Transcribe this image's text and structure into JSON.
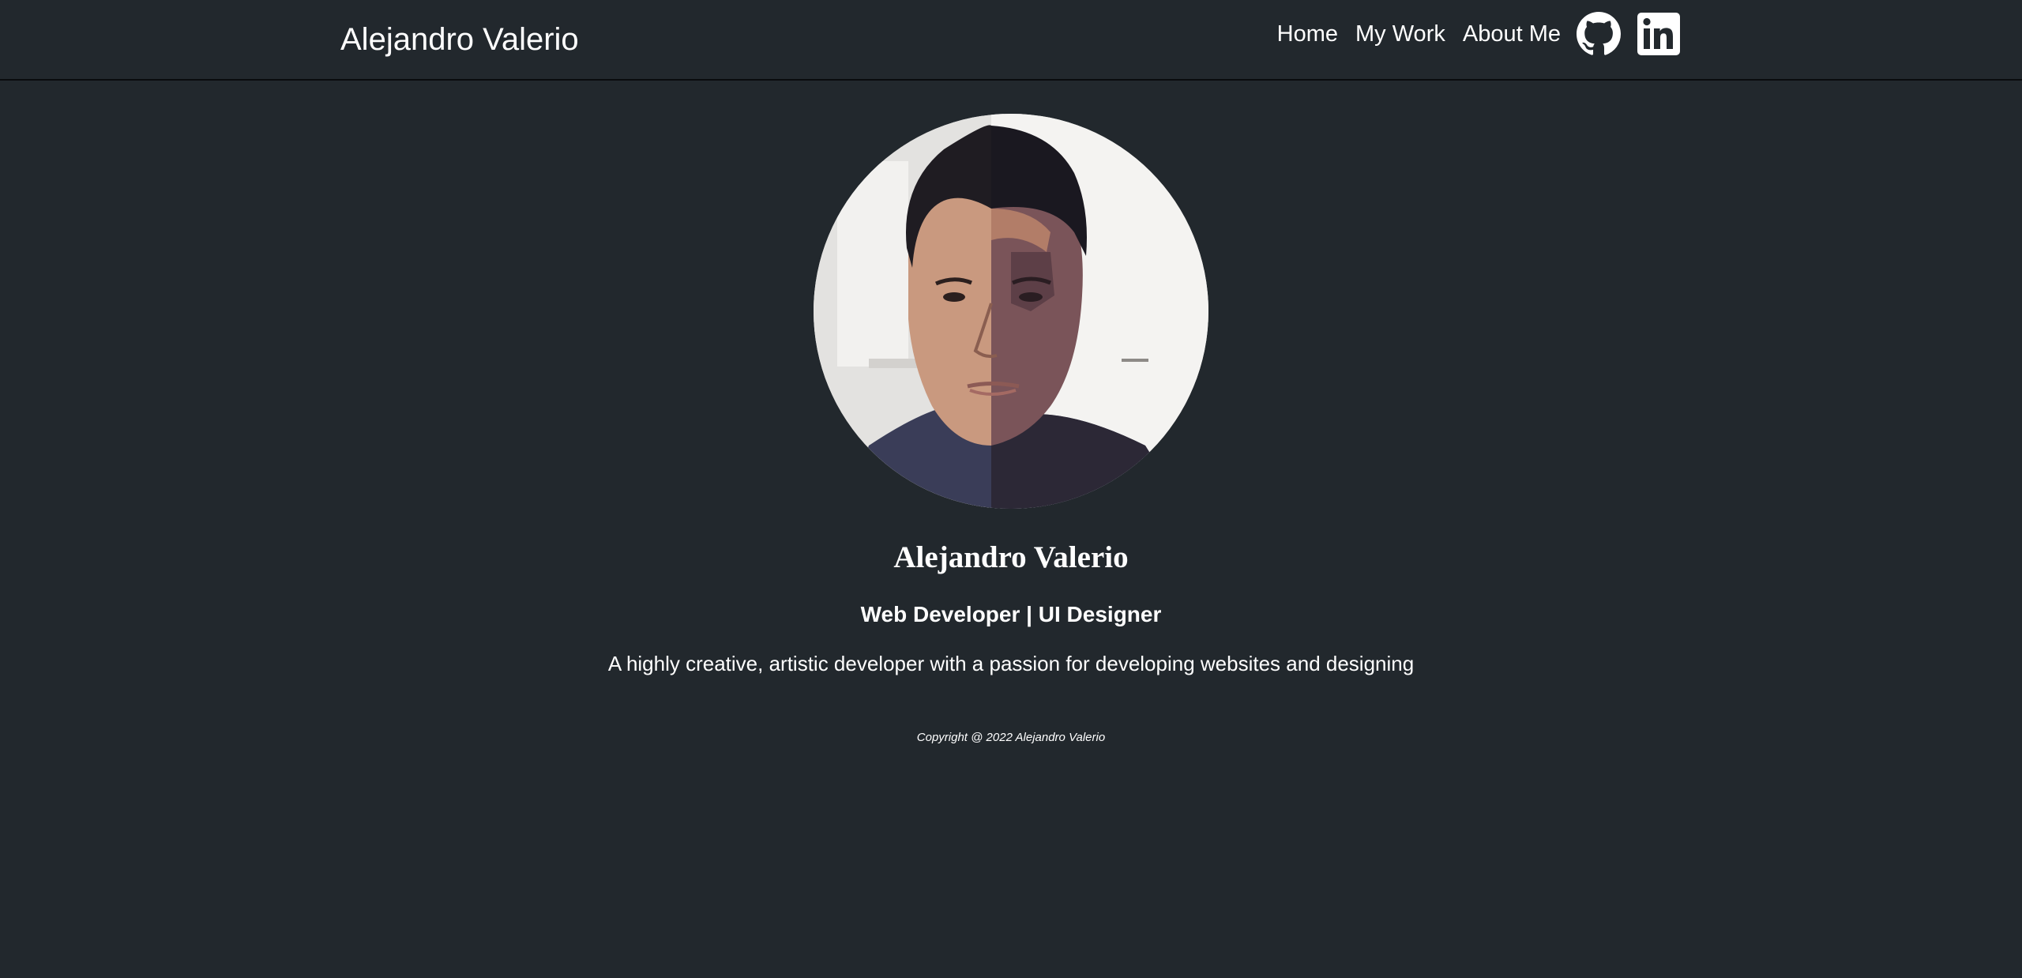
{
  "header": {
    "brand": "Alejandro Valerio",
    "nav": {
      "home": "Home",
      "work": "My Work",
      "about": "About Me"
    },
    "social_icons": [
      "github-icon",
      "linkedin-icon"
    ]
  },
  "hero": {
    "name": "Alejandro Valerio",
    "role": "Web Developer | UI Designer",
    "description": "A highly creative, artistic developer with a passion for developing websites and designing"
  },
  "footer": {
    "copyright": "Copyright @ 2022 Alejandro Valerio"
  },
  "colors": {
    "background": "#22282d",
    "text": "#ffffff",
    "divider": "#0a0c0e"
  }
}
